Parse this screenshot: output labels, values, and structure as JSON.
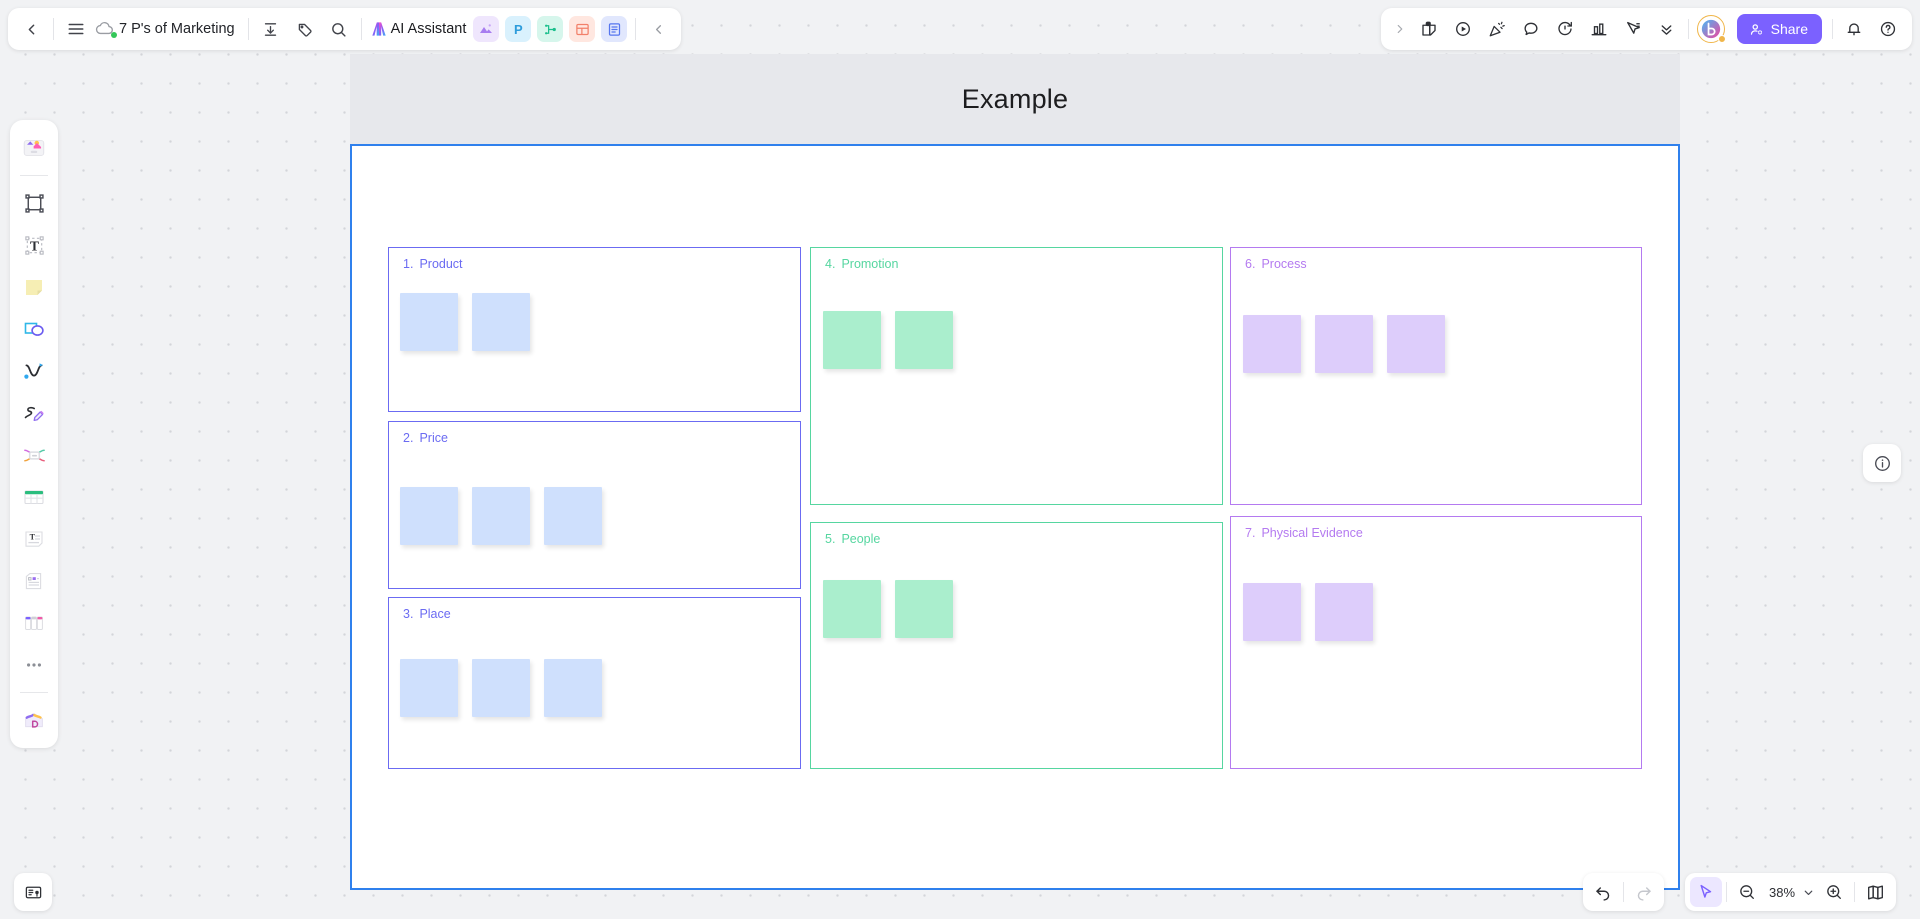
{
  "topbar": {
    "back_icon": "chevron-left-icon",
    "menu_icon": "hamburger-menu-icon",
    "cloud_icon": "cloud-sync-icon",
    "doc_title": "7 P's of Marketing",
    "import_icon": "import-icon",
    "tag_icon": "tag-icon",
    "search_icon": "search-icon",
    "ai_label": "AI Assistant",
    "apps": [
      {
        "name": "image-app-chip",
        "letter": ""
      },
      {
        "name": "presentation-app-chip",
        "letter": "P"
      },
      {
        "name": "mindmap-app-chip",
        "letter": ""
      },
      {
        "name": "table-app-chip",
        "letter": ""
      },
      {
        "name": "docs-app-chip",
        "letter": ""
      }
    ],
    "collapse_icon": "chevron-left-icon"
  },
  "rightbar": {
    "expand_icon": "chevron-right-icon",
    "tools": [
      "sticker-note-icon",
      "play-circle-icon",
      "party-popper-icon",
      "comment-bubble-icon",
      "timer-icon",
      "vote-chart-icon",
      "cursor-pointer-icon",
      "chevron-double-down-icon"
    ],
    "brand_badge": "boardmix-brand-icon",
    "share_label": "Share",
    "share_icon": "user-add-icon",
    "share_color": "#7b61ff",
    "bell_icon": "notification-bell-icon",
    "help_icon": "help-circle-icon"
  },
  "leftrail": {
    "tools": [
      "templates-icon",
      "frame-icon",
      "text-icon",
      "sticky-note-icon",
      "shapes-icon",
      "connector-line-icon",
      "pen-draw-icon",
      "mindmap-icon",
      "table-icon",
      "text-card-icon",
      "document-icon",
      "kanban-board-icon",
      "more-options-icon",
      "ai-generate-icon"
    ]
  },
  "board": {
    "frame_title": "Example",
    "frame_border_color": "#2f80ed",
    "sections": [
      {
        "number": "1.",
        "label": "Product",
        "theme": "blue",
        "note_color": "#cfe0fd",
        "border_color": "#6b6bf2",
        "notes": 2
      },
      {
        "number": "2.",
        "label": "Price",
        "theme": "blue",
        "note_color": "#cfe0fd",
        "border_color": "#6b6bf2",
        "notes": 3
      },
      {
        "number": "3.",
        "label": "Place",
        "theme": "blue",
        "note_color": "#cfe0fd",
        "border_color": "#6b6bf2",
        "notes": 3
      },
      {
        "number": "4.",
        "label": "Promotion",
        "theme": "green",
        "note_color": "#aaeecd",
        "border_color": "#56d6a0",
        "notes": 2
      },
      {
        "number": "5.",
        "label": "People",
        "theme": "green",
        "note_color": "#aaeecd",
        "border_color": "#56d6a0",
        "notes": 2
      },
      {
        "number": "6.",
        "label": "Process",
        "theme": "purple",
        "note_color": "#ddcdfb",
        "border_color": "#b47af0",
        "notes": 3
      },
      {
        "number": "7.",
        "label": "Physical Evidence",
        "theme": "purple",
        "note_color": "#ddcdfb",
        "border_color": "#b47af0",
        "notes": 2
      }
    ]
  },
  "bottom": {
    "undo_icon": "undo-arrow-icon",
    "redo_icon": "redo-arrow-icon",
    "cursor_icon": "cursor-select-icon",
    "zoom_out_icon": "zoom-out-icon",
    "zoom_level": "38%",
    "zoom_dropdown_icon": "chevron-down-icon",
    "zoom_in_icon": "zoom-in-icon",
    "minimap_icon": "minimap-icon",
    "info_icon": "info-circle-icon",
    "presenter_icon": "presenter-notes-icon"
  }
}
